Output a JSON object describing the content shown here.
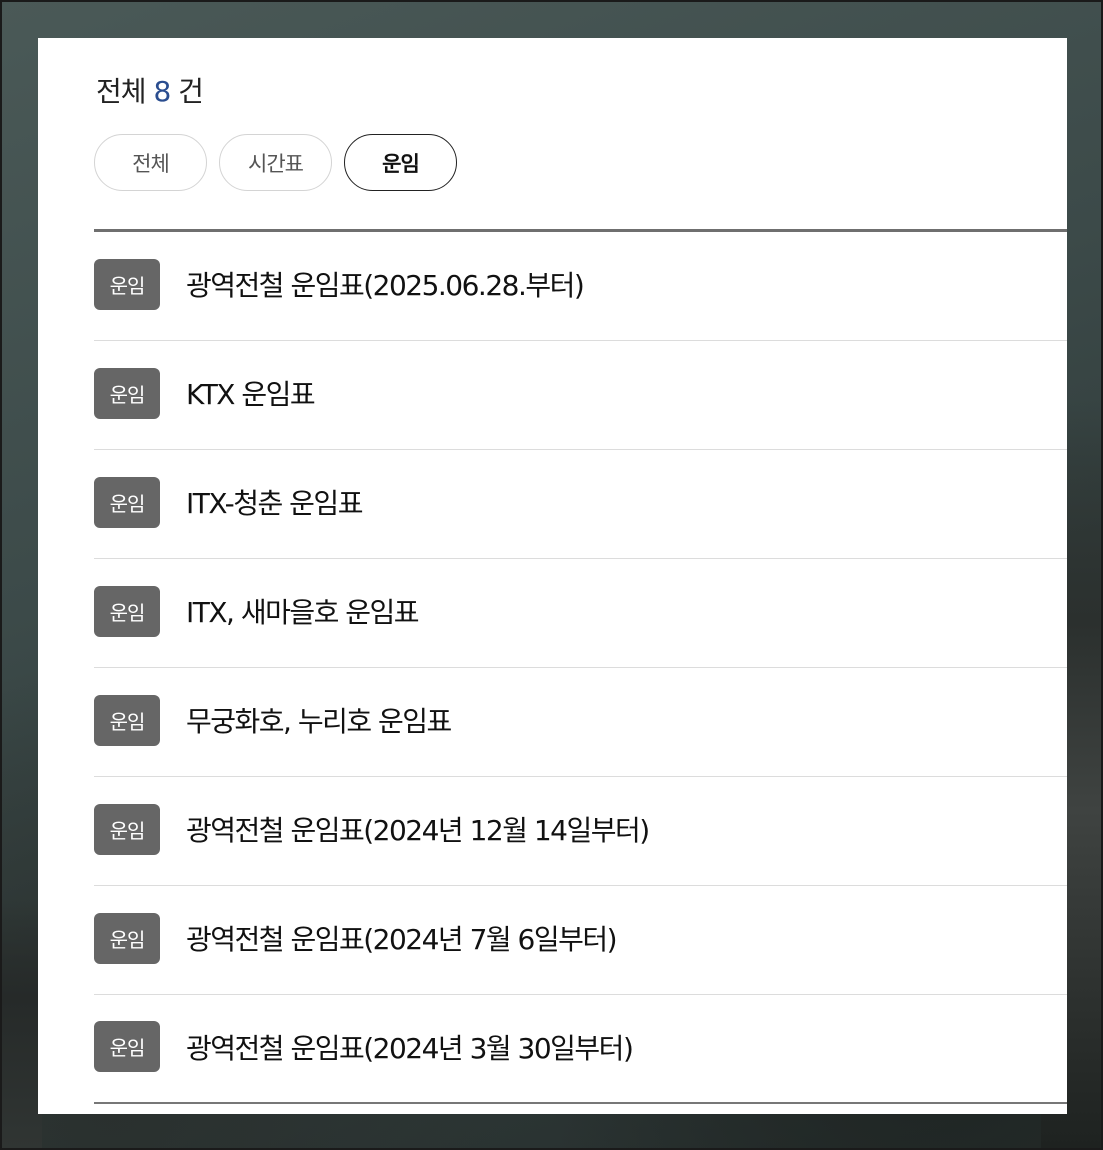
{
  "summary": {
    "prefix": "전체",
    "count": "8",
    "suffix": "건"
  },
  "filters": [
    {
      "label": "전체",
      "active": false
    },
    {
      "label": "시간표",
      "active": false
    },
    {
      "label": "운임",
      "active": true
    }
  ],
  "items": [
    {
      "badge": "운임",
      "title": "광역전철 운임표(2025.06.28.부터)"
    },
    {
      "badge": "운임",
      "title": "KTX 운임표"
    },
    {
      "badge": "운임",
      "title": "ITX-청춘 운임표"
    },
    {
      "badge": "운임",
      "title": "ITX, 새마을호 운임표"
    },
    {
      "badge": "운임",
      "title": "무궁화호, 누리호 운임표"
    },
    {
      "badge": "운임",
      "title": "광역전철 운임표(2024년 12월 14일부터)"
    },
    {
      "badge": "운임",
      "title": "광역전철 운임표(2024년 7월 6일부터)"
    },
    {
      "badge": "운임",
      "title": "광역전철 운임표(2024년 3월 30일부터)"
    }
  ],
  "colors": {
    "accent": "#2a4d8f",
    "badge_bg": "#666666"
  }
}
